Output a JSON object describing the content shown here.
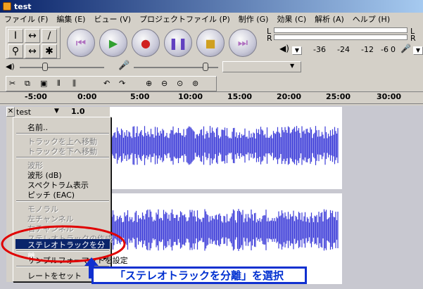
{
  "window": {
    "title": "test"
  },
  "menu": [
    "ファイル (F)",
    "編集 (E)",
    "ビュー (V)",
    "プロジェクトファイル (P)",
    "制作 (G)",
    "効果 (C)",
    "解析 (A)",
    "ヘルプ (H)"
  ],
  "tools": [
    "I",
    "↔",
    "∕",
    "⚲",
    "↔",
    "✱"
  ],
  "meters": {
    "l": "L",
    "r": "R",
    "scale": [
      "-36",
      "-24",
      "-12",
      "-6",
      "0"
    ]
  },
  "ruler": [
    "-5:00",
    "0:00",
    "5:00",
    "10:00",
    "15:00",
    "20:00",
    "25:00",
    "30:00"
  ],
  "track": {
    "name": "test",
    "rate": "1.0"
  },
  "context_menu": {
    "items": [
      "名前..",
      "トラックを上へ移動",
      "トラックを下へ移動",
      "波形",
      "波形 (dB)",
      "スペクトラム表示",
      "ピッチ (EAC)",
      "モノラル",
      "左チャンネル",
      "右チャンネル",
      "ステレオトラックの作成",
      "ステレオトラックを分離",
      "サンプルフォーマットを設定",
      "レートをセット"
    ],
    "disabled": [
      1,
      2,
      3,
      7,
      8,
      9,
      10
    ],
    "selected_index": 11
  },
  "callout": "「ステレオトラックを分離」を選択",
  "colors": {
    "wave": "#3c3cd8",
    "highlight": "#0a246a",
    "callout_border": "#1030d0",
    "ellipse": "#e00000"
  }
}
